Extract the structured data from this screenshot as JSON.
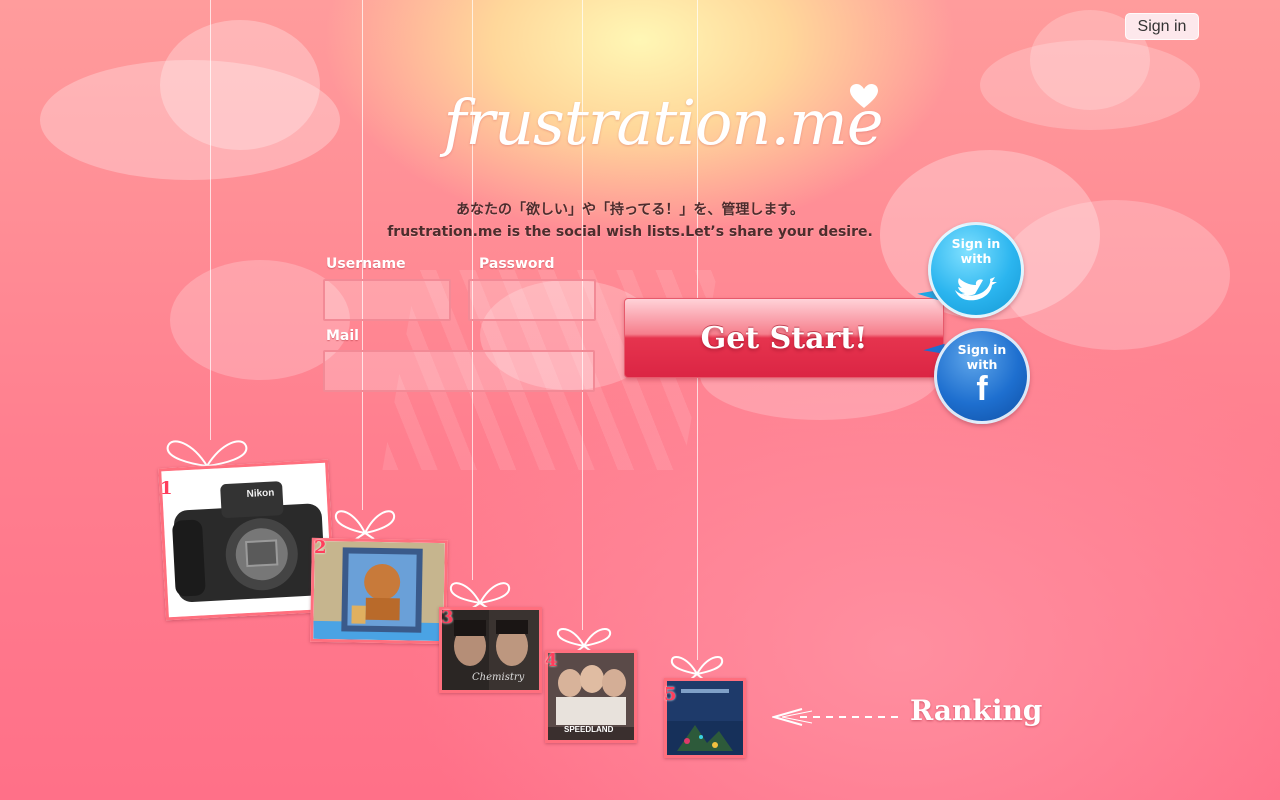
{
  "header": {
    "signin_label": "Sign in"
  },
  "logo": {
    "text": "frustration.me"
  },
  "tagline": {
    "ja": "あなたの「欲しい」や「持ってる！」を、管理します。",
    "en": "frustration.me is the social wish lists.Let’s share your desire."
  },
  "form": {
    "username_label": "Username",
    "password_label": "Password",
    "mail_label": "Mail",
    "username_value": "",
    "password_value": "",
    "mail_value": "",
    "submit_label": "Get Start!"
  },
  "social": {
    "twitter": {
      "label": "Sign in with",
      "icon": "twitter-bird-icon",
      "color": "#2bb5ef"
    },
    "facebook": {
      "label": "Sign in with",
      "icon": "facebook-f-icon",
      "color": "#1e6fcf"
    }
  },
  "ranking": {
    "label": "Ranking",
    "items": [
      {
        "rank": "1",
        "title": "Nikon",
        "theme": "camera"
      },
      {
        "rank": "2",
        "title": "",
        "theme": "figure"
      },
      {
        "rank": "3",
        "title": "Chemistry",
        "theme": "album-duo"
      },
      {
        "rank": "4",
        "title": "SPEEDLAND",
        "theme": "album-group"
      },
      {
        "rank": "5",
        "title": "",
        "theme": "album-night"
      }
    ]
  },
  "colors": {
    "background": "#ff7f8f",
    "accent": "#e6344e",
    "frame": "#ff6f7e"
  }
}
